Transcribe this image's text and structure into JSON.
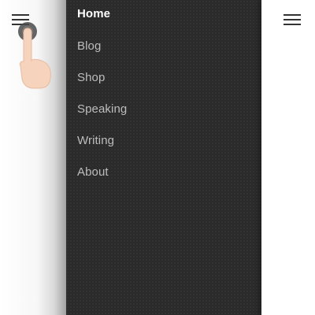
{
  "nav": {
    "items": [
      {
        "label": "Home",
        "active": true
      },
      {
        "label": "Blog",
        "active": false
      },
      {
        "label": "Shop",
        "active": false
      },
      {
        "label": "Speaking",
        "active": false
      },
      {
        "label": "Writing",
        "active": false
      },
      {
        "label": "About",
        "active": false
      }
    ]
  },
  "icons": {
    "left_menu": "hamburger-menu-icon",
    "right_menu": "hamburger-menu-icon",
    "gesture": "tap-hand-icon"
  },
  "colors": {
    "drawer_bg": "#2b2b2b",
    "active_text": "#ffffff",
    "inactive_text": "#bdbdbd",
    "icon": "#333333",
    "hand_skin": "#f6d3bd",
    "tap_ring": "#4a4a4a"
  }
}
